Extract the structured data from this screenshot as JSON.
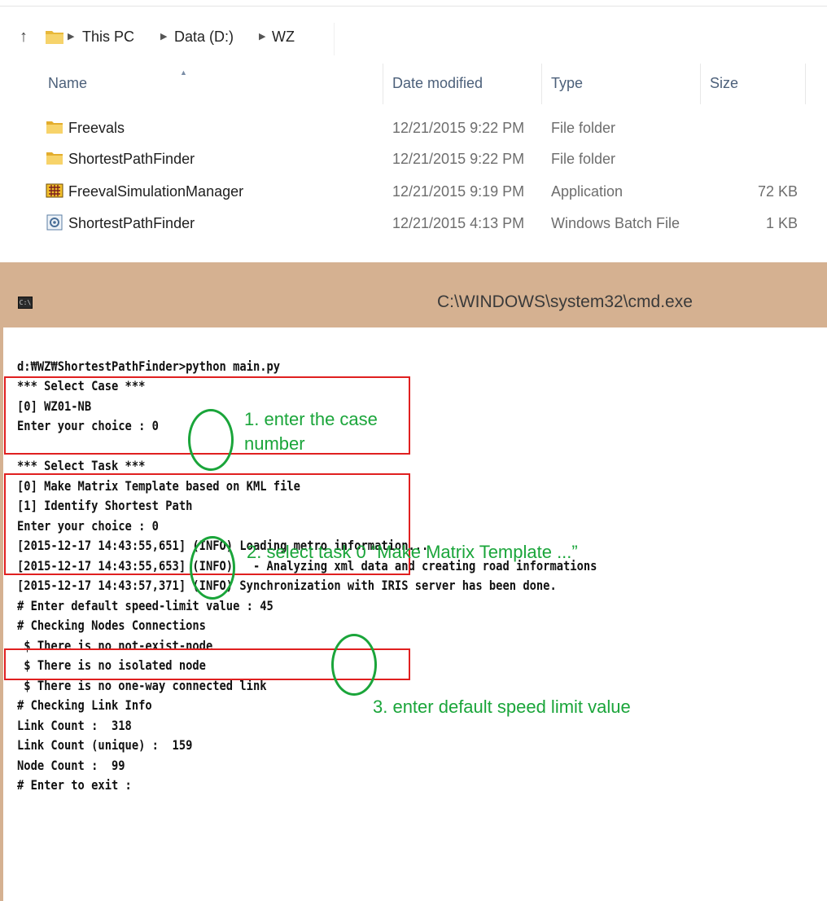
{
  "explorer": {
    "breadcrumb": [
      "This PC",
      "Data (D:)",
      "WZ"
    ],
    "columns": {
      "name": "Name",
      "date": "Date modified",
      "type": "Type",
      "size": "Size"
    },
    "files": [
      {
        "name": "Freevals",
        "date": "12/21/2015 9:22 PM",
        "type": "File folder",
        "size": "",
        "icon": "folder-icon"
      },
      {
        "name": "ShortestPathFinder",
        "date": "12/21/2015 9:22 PM",
        "type": "File folder",
        "size": "",
        "icon": "folder-icon"
      },
      {
        "name": "FreevalSimulationManager",
        "date": "12/21/2015 9:19 PM",
        "type": "Application",
        "size": "72 KB",
        "icon": "application-icon"
      },
      {
        "name": "ShortestPathFinder",
        "date": "12/21/2015 4:13 PM",
        "type": "Windows Batch File",
        "size": "1 KB",
        "icon": "batch-file-icon"
      }
    ]
  },
  "cmd": {
    "title": "C:\\WINDOWS\\system32\\cmd.exe",
    "lines": [
      "d:₩WZ₩ShortestPathFinder>python main.py",
      "*** Select Case ***",
      "[0] WZ01-NB",
      "Enter your choice : 0",
      "",
      "*** Select Task ***",
      "[0] Make Matrix Template based on KML file",
      "[1] Identify Shortest Path",
      "Enter your choice : 0",
      "[2015-12-17 14:43:55,651] (INFO) Loading metro information...",
      "[2015-12-17 14:43:55,653] (INFO)   - Analyzing xml data and creating road informations",
      "[2015-12-17 14:43:57,371] (INFO) Synchronization with IRIS server has been done.",
      "# Enter default speed-limit value : 45",
      "# Checking Nodes Connections",
      " $ There is no not-exist-node",
      " $ There is no isolated node",
      " $ There is no one-way connected link",
      "# Checking Link Info",
      "Link Count :  318",
      "Link Count (unique) :  159",
      "Node Count :  99",
      "# Enter to exit :"
    ]
  },
  "annotations": {
    "note1": "1. enter the case number",
    "note2": "2. select task 0 “Make Matrix Template ...”",
    "note3": "3. enter default speed limit value"
  },
  "colors": {
    "annotation_green": "#1aa53a",
    "annotation_red": "#e02020",
    "cmd_title_bar": "#d5b191"
  }
}
